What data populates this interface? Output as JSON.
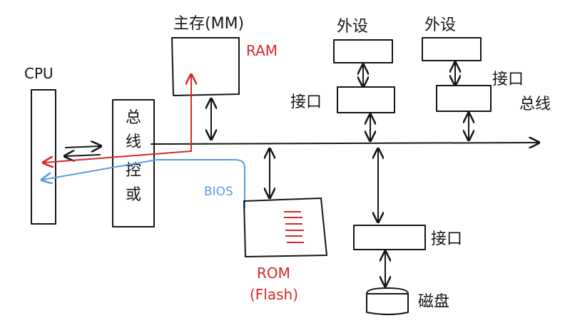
{
  "labels": {
    "cpu": "CPU",
    "main_memory": "主存(MM)",
    "ram": "RAM",
    "bus_controller": [
      "总",
      "线",
      "控",
      "或"
    ],
    "bios": "BIOS",
    "rom": "ROM",
    "flash": "(Flash)",
    "peripheral_1": "外设",
    "peripheral_2": "外设",
    "interface_1": "接口",
    "interface_2": "接口",
    "interface_3": "接口",
    "system_bus": "总线",
    "disk": "磁盘"
  },
  "colors": {
    "ink": "#151515",
    "ram_path": "#d62828",
    "bios_path": "#5a9be0",
    "rom_lines": "#d62828"
  }
}
